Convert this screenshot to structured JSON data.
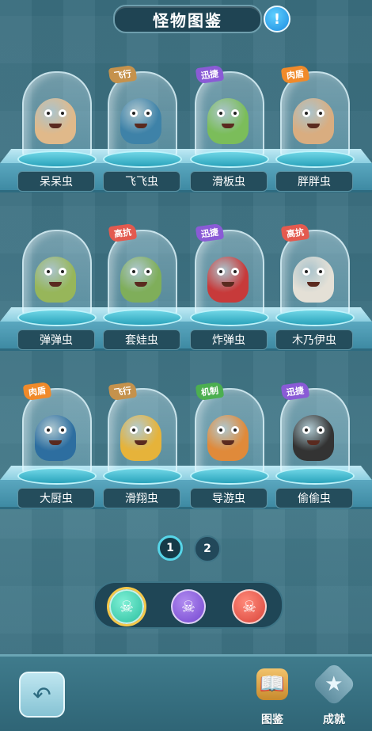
{
  "header": {
    "title": "怪物图鉴",
    "info_icon": "exclamation-icon"
  },
  "monsters": [
    {
      "name": "呆呆虫",
      "tag": "",
      "color": "#e0b98a"
    },
    {
      "name": "飞飞虫",
      "tag": "飞行",
      "color": "#3e82a8"
    },
    {
      "name": "滑板虫",
      "tag": "迅捷",
      "color": "#7bbd5a"
    },
    {
      "name": "胖胖虫",
      "tag": "肉盾",
      "color": "#d9ad80"
    },
    {
      "name": "弹弹虫",
      "tag": "",
      "color": "#97b65a"
    },
    {
      "name": "套娃虫",
      "tag": "高抗",
      "color": "#7fae5a"
    },
    {
      "name": "炸弹虫",
      "tag": "迅捷",
      "color": "#c73a3a"
    },
    {
      "name": "木乃伊虫",
      "tag": "高抗",
      "color": "#e4e0d6"
    },
    {
      "name": "大厨虫",
      "tag": "肉盾",
      "color": "#2d6ea0"
    },
    {
      "name": "滑翔虫",
      "tag": "飞行",
      "color": "#e6b33a"
    },
    {
      "name": "导游虫",
      "tag": "机制",
      "color": "#e08a3a"
    },
    {
      "name": "偷偷虫",
      "tag": "迅捷",
      "color": "#333333"
    }
  ],
  "pagination": {
    "pages": [
      "1",
      "2"
    ],
    "current": "1"
  },
  "filters": [
    {
      "icon": "skull-icon",
      "glyph": "☠",
      "selected": true
    },
    {
      "icon": "skull-crossbones-icon",
      "glyph": "☠",
      "selected": false
    },
    {
      "icon": "flame-skull-icon",
      "glyph": "☠",
      "selected": false
    }
  ],
  "bottom_nav": {
    "back_icon": "back-arrow-icon",
    "back_glyph": "↶",
    "guide_label": "图鉴",
    "guide_glyph": "📖",
    "achieve_label": "成就",
    "achieve_glyph": "★"
  }
}
